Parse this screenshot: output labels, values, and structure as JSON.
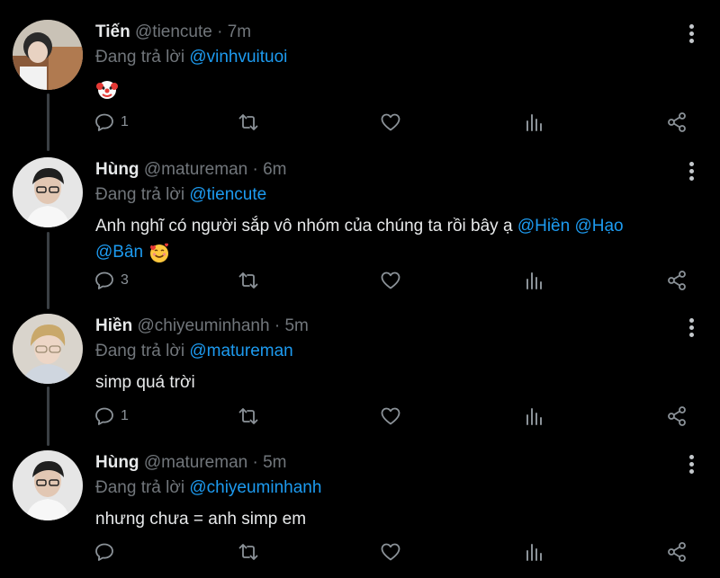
{
  "tweets": [
    {
      "name": "Tiến",
      "handle": "@tiencute",
      "time": "7m",
      "replying_prefix": "Đang trả lời",
      "replying_to": "@vinhvuituoi",
      "text": "",
      "emoji": "clown-face",
      "reply_count": "1"
    },
    {
      "name": "Hùng",
      "handle": "@matureman",
      "time": "6m",
      "replying_prefix": "Đang trả lời",
      "replying_to": "@tiencute",
      "text_line1": "Anh nghĩ có người sắp vô nhóm của chúng ta rồi bây ạ",
      "mention_1": "@Hiền",
      "mention_2": "@Hạo",
      "mention_3": "@Bân",
      "emoji": "smiling-face-with-hearts",
      "reply_count": "3"
    },
    {
      "name": "Hiền",
      "handle": "@chiyeuminhanh",
      "time": "5m",
      "replying_prefix": "Đang trả lời",
      "replying_to": "@matureman",
      "text": "simp quá trời",
      "reply_count": "1"
    },
    {
      "name": "Hùng",
      "handle": "@matureman",
      "time": "5m",
      "replying_prefix": "Đang trả lời",
      "replying_to": "@chiyeuminhanh",
      "text": "nhưng chưa = anh simp em",
      "reply_count": ""
    }
  ],
  "colors": {
    "background": "#000000",
    "text": "#e7e9ea",
    "muted": "#71767b",
    "mention": "#1d9bf0",
    "thread_line": "#3a3f44"
  },
  "separator": " · "
}
